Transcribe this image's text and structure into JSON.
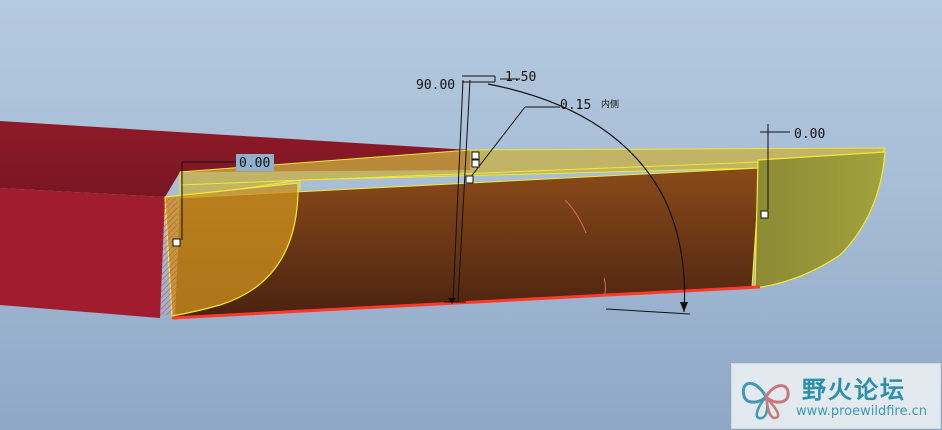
{
  "dimensions": {
    "angle": "90.00",
    "thickness": "1.50",
    "radius": "0.15",
    "radius_note": "内侧",
    "left_offset": "0.00",
    "right_offset": "0.00"
  },
  "watermark": {
    "title": "野火论坛",
    "url": "www.proewildfire.cn"
  },
  "colors": {
    "background_top": "#b5cadf",
    "background_bottom": "#8ea7c6",
    "solid_red": "#a01c2e",
    "preview_brown": "#6a3416",
    "preview_yellow": "#c89a1a",
    "highlight_edge": "#ff3a2a"
  }
}
